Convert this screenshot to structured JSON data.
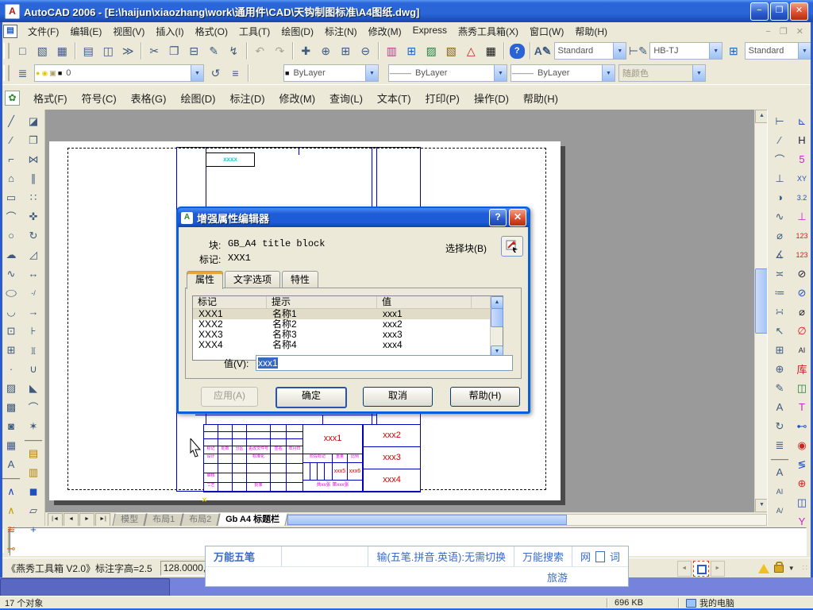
{
  "window": {
    "title": "AutoCAD 2006 - [E:\\haijun\\xiaozhang\\work\\通用件\\CAD\\天钩制图标准\\A4图纸.dwg]",
    "controls": {
      "minimize": "−",
      "restore": "❐",
      "close": "✕"
    },
    "doc_controls": "− ❐ ✕"
  },
  "menus": [
    "文件(F)",
    "编辑(E)",
    "视图(V)",
    "插入(I)",
    "格式(O)",
    "工具(T)",
    "绘图(D)",
    "标注(N)",
    "修改(M)",
    "Express",
    "燕秀工具箱(X)",
    "窗口(W)",
    "帮助(H)"
  ],
  "menus2": [
    "格式(F)",
    "符号(C)",
    "表格(G)",
    "绘图(D)",
    "标注(D)",
    "修改(M)",
    "查询(L)",
    "文本(T)",
    "打印(P)",
    "操作(D)",
    "帮助(H)"
  ],
  "toolbar_standard": [
    {
      "n": "new",
      "g": "□"
    },
    {
      "n": "open",
      "g": "▧"
    },
    {
      "n": "save",
      "g": "▦"
    },
    {
      "sep": true
    },
    {
      "n": "plot",
      "g": "▤"
    },
    {
      "n": "plot-preview",
      "g": "◫"
    },
    {
      "n": "publish",
      "g": "≫"
    },
    {
      "sep": true
    },
    {
      "n": "cut",
      "g": "✂"
    },
    {
      "n": "copy-clip",
      "g": "❐"
    },
    {
      "n": "paste",
      "g": "⊟"
    },
    {
      "n": "match-properties",
      "g": "✎"
    },
    {
      "n": "block-editor",
      "g": "↯"
    },
    {
      "sep": true
    },
    {
      "n": "undo",
      "g": "↶",
      "muted": true
    },
    {
      "n": "redo",
      "g": "↷",
      "muted": true
    },
    {
      "sep": true
    },
    {
      "n": "pan",
      "g": "✚"
    },
    {
      "n": "zoom-realtime",
      "g": "⊕"
    },
    {
      "n": "zoom-window",
      "g": "⊞"
    },
    {
      "n": "zoom-previous",
      "g": "⊖"
    },
    {
      "sep": true
    },
    {
      "n": "properties",
      "g": "▥",
      "c": "#b04090"
    },
    {
      "n": "designcenter",
      "g": "⊞",
      "c": "#2060c0"
    },
    {
      "n": "tool-palettes",
      "g": "▨",
      "c": "#208040"
    },
    {
      "n": "sheet-set-manager",
      "g": "▧",
      "c": "#806010"
    },
    {
      "n": "markup-set-manager",
      "g": "△",
      "c": "#c02020"
    },
    {
      "n": "quick-calc",
      "g": "▦",
      "c": "#111"
    },
    {
      "sep": true
    },
    {
      "n": "help",
      "g": "?",
      "help": true
    }
  ],
  "styles_toolbar": {
    "text_style": "Standard",
    "dim_style": "HB-TJ",
    "table_style": "Standard"
  },
  "layers_toolbar": {
    "layer": "0",
    "color": "ByLayer",
    "linetype": "ByLayer",
    "lineweight": "ByLayer",
    "plot_style": "随颜色",
    "line_sample": "———"
  },
  "draw_tools": [
    {
      "n": "line",
      "g": "╱"
    },
    {
      "n": "construction-line",
      "g": "⁄"
    },
    {
      "n": "polyline",
      "g": "⌐"
    },
    {
      "n": "polygon",
      "g": "⌂"
    },
    {
      "n": "rectangle",
      "g": "▭"
    },
    {
      "n": "arc",
      "g": "⌒"
    },
    {
      "n": "circle",
      "g": "○"
    },
    {
      "n": "revcloud",
      "g": "☁"
    },
    {
      "n": "spline",
      "g": "∿"
    },
    {
      "n": "ellipse",
      "g": "◯",
      "sq": true
    },
    {
      "n": "ellipse-arc",
      "g": "◡"
    },
    {
      "n": "insert-block",
      "g": "⊡"
    },
    {
      "n": "make-block",
      "g": "⊞"
    },
    {
      "n": "point",
      "g": "·"
    },
    {
      "n": "hatch",
      "g": "▨"
    },
    {
      "n": "gradient",
      "g": "▩"
    },
    {
      "n": "region",
      "g": "◙"
    },
    {
      "n": "table",
      "g": "▦"
    },
    {
      "n": "mtext",
      "g": "A"
    },
    {
      "sep": true
    },
    {
      "n": "yx-bracket",
      "g": "∧",
      "c": "#2040d0"
    },
    {
      "n": "yx-bracket-2",
      "g": "∧",
      "c": "#c0a000"
    },
    {
      "n": "yx-ruler",
      "g": "≋",
      "c": "#c05010"
    },
    {
      "n": "yx-ruler-2",
      "g": "⊸",
      "c": "#c07010"
    }
  ],
  "modify_tools": [
    {
      "n": "erase",
      "g": "◪"
    },
    {
      "n": "copy",
      "g": "❐"
    },
    {
      "n": "mirror",
      "g": "⋈"
    },
    {
      "n": "offset",
      "g": "∥"
    },
    {
      "n": "array",
      "g": "∷"
    },
    {
      "n": "move",
      "g": "✜"
    },
    {
      "n": "rotate",
      "g": "↻"
    },
    {
      "n": "scale",
      "g": "◿"
    },
    {
      "n": "stretch",
      "g": "↔"
    },
    {
      "n": "trim",
      "g": "-/"
    },
    {
      "n": "extend",
      "g": "→"
    },
    {
      "n": "break-at-point",
      "g": "⊦"
    },
    {
      "n": "break",
      "g": "]["
    },
    {
      "n": "join",
      "g": "∪"
    },
    {
      "n": "chamfer",
      "g": "◣"
    },
    {
      "n": "fillet",
      "g": "⌒"
    },
    {
      "n": "explode",
      "g": "✶"
    },
    {
      "sep": true
    },
    {
      "n": "yx-scale-bar",
      "g": "▤",
      "c": "#b08000"
    },
    {
      "n": "yx-scale-bar-2",
      "g": "▥",
      "c": "#b08000"
    },
    {
      "n": "yx-block-tool",
      "g": "◼",
      "c": "#2050c0"
    },
    {
      "n": "yx-sheet",
      "g": "▱",
      "c": "#2050c0"
    },
    {
      "n": "yx-coord",
      "g": "+",
      "c": "#2050c0"
    }
  ],
  "dim_tools": [
    {
      "n": "dim-linear",
      "g": "⊢"
    },
    {
      "n": "dim-aligned",
      "g": "∕"
    },
    {
      "n": "dim-arc-length",
      "g": "⌒"
    },
    {
      "n": "dim-ordinate",
      "g": "⊥"
    },
    {
      "n": "dim-radius",
      "g": "◑"
    },
    {
      "n": "dim-jogged",
      "g": "∿"
    },
    {
      "n": "dim-diameter",
      "g": "⌀"
    },
    {
      "n": "dim-angular",
      "g": "∡"
    },
    {
      "n": "quick-dim",
      "g": "≍"
    },
    {
      "n": "dim-baseline",
      "g": "≔"
    },
    {
      "n": "dim-continue",
      "g": "∺"
    },
    {
      "n": "quick-leader",
      "g": "↖"
    },
    {
      "n": "tolerance",
      "g": "⊞"
    },
    {
      "n": "center-mark",
      "g": "⊕"
    },
    {
      "n": "dim-edit",
      "g": "✎"
    },
    {
      "n": "dim-text-edit",
      "g": "A"
    },
    {
      "n": "dim-update",
      "g": "↻"
    },
    {
      "n": "dim-style",
      "g": "≣"
    },
    {
      "sep": true
    },
    {
      "n": "text-single",
      "g": "A"
    },
    {
      "n": "text-edit",
      "g": "AI"
    },
    {
      "n": "text-scale",
      "g": "A/"
    }
  ],
  "yx_dim_tools": [
    {
      "n": "yx-angle-dim",
      "g": "⊾",
      "c": "#2050c0"
    },
    {
      "n": "yx-h-dim",
      "g": "H",
      "c": "#223"
    },
    {
      "n": "yx-leader-5",
      "g": "5",
      "c": "#d020d0"
    },
    {
      "n": "yx-xy-dim",
      "g": "XY",
      "c": "#2050c0"
    },
    {
      "n": "yx-roughness",
      "g": "3.2",
      "c": "#2050c0"
    },
    {
      "n": "yx-datum",
      "g": "⊥",
      "c": "#d020d0"
    },
    {
      "n": "yx-number-1",
      "g": "123",
      "c": "#d02020"
    },
    {
      "n": "yx-number-2",
      "g": "123",
      "c": "#d02020"
    },
    {
      "n": "yx-dia-dim",
      "g": "⊘",
      "c": "#223"
    },
    {
      "n": "yx-dia-dim-2",
      "g": "⊘",
      "c": "#2050c0"
    },
    {
      "n": "yx-dia-dim-3",
      "g": "⌀",
      "c": "#223"
    },
    {
      "n": "yx-dia-dim-4",
      "g": "∅",
      "c": "#d02020"
    },
    {
      "n": "yx-text-ai",
      "g": "AI",
      "c": "#223"
    },
    {
      "n": "yx-library",
      "g": "库",
      "c": "#d02020"
    },
    {
      "n": "yx-mold-base",
      "g": "◫",
      "c": "#208040"
    },
    {
      "n": "yx-screw",
      "g": "T",
      "c": "#d020d0"
    },
    {
      "n": "yx-pin",
      "g": "⊷",
      "c": "#2050c0"
    },
    {
      "n": "yx-wheel",
      "g": "◉",
      "c": "#d02020"
    },
    {
      "n": "yx-spring",
      "g": "≶",
      "c": "#2050c0"
    },
    {
      "n": "yx-circle-tool",
      "g": "⊕",
      "c": "#d02020"
    },
    {
      "n": "yx-slide",
      "g": "◫",
      "c": "#2050c0"
    },
    {
      "n": "yx-funnel",
      "g": "Y",
      "c": "#d020d0"
    }
  ],
  "dialog": {
    "title": "增强属性编辑器",
    "help_btn": "?",
    "close_btn": "✕",
    "block_label": "块:",
    "block_value": "GB_A4 title block",
    "tag_label": "标记:",
    "tag_value": "XXX1",
    "select_block": "选择块(B)",
    "tabs": [
      "属性",
      "文字选项",
      "特性"
    ],
    "table": {
      "headers": [
        "标记",
        "提示",
        "值"
      ],
      "rows": [
        [
          "XXX1",
          "名称1",
          "xxx1"
        ],
        [
          "XXX2",
          "名称2",
          "xxx2"
        ],
        [
          "XXX3",
          "名称3",
          "xxx3"
        ],
        [
          "XXX4",
          "名称4",
          "xxx4"
        ]
      ]
    },
    "value_label": "值(V):",
    "value_text": "xxx1",
    "buttons": {
      "apply": "应用(A)",
      "ok": "确定",
      "cancel": "取消",
      "help": "帮助(H)"
    }
  },
  "drawing": {
    "tag_text": "xxxx",
    "title_block": {
      "values": {
        "v1": "xxx1",
        "v2": "xxx2",
        "v3": "xxx3",
        "v4": "xxx4",
        "v5": "xxx5",
        "v6": "xxx6"
      },
      "row_labels": [
        "标记",
        "处数",
        "分区",
        "更改文件号",
        "签名",
        "年月日"
      ],
      "left_rows": [
        [
          "设计",
          "",
          "",
          "标准化",
          "",
          ""
        ],
        [
          "",
          "",
          "",
          "",
          "",
          ""
        ],
        [
          "审核",
          "",
          "",
          "",
          "",
          ""
        ],
        [
          "工艺",
          "",
          "",
          "批准",
          "",
          ""
        ]
      ],
      "mid_labels": {
        "stage": "阶段标记",
        "weight": "重量",
        "scale": "比例",
        "sheets": "共xx张",
        "sheet_no": "第xxx张"
      }
    },
    "pick_mark": "✕",
    "snap_mark": "✕"
  },
  "layout_tabs": [
    "模型",
    "布局1",
    "布局2",
    "Gb A4 标题栏"
  ],
  "tab_nav": [
    "|◄",
    "◄",
    "►",
    "►|"
  ],
  "status": {
    "message": "《燕秀工具箱 V2.0》标注字高=2.5",
    "coords": "128.0000,"
  },
  "ime": {
    "name": "万能五笔",
    "hint": "输(五笔.拼音.英语):无需切换",
    "search": "万能搜索",
    "net": "网",
    "doc": "词",
    "hot": "旅游"
  },
  "explorer": {
    "objects": "17 个对象",
    "size": "696 KB",
    "device": "我的电脑"
  }
}
